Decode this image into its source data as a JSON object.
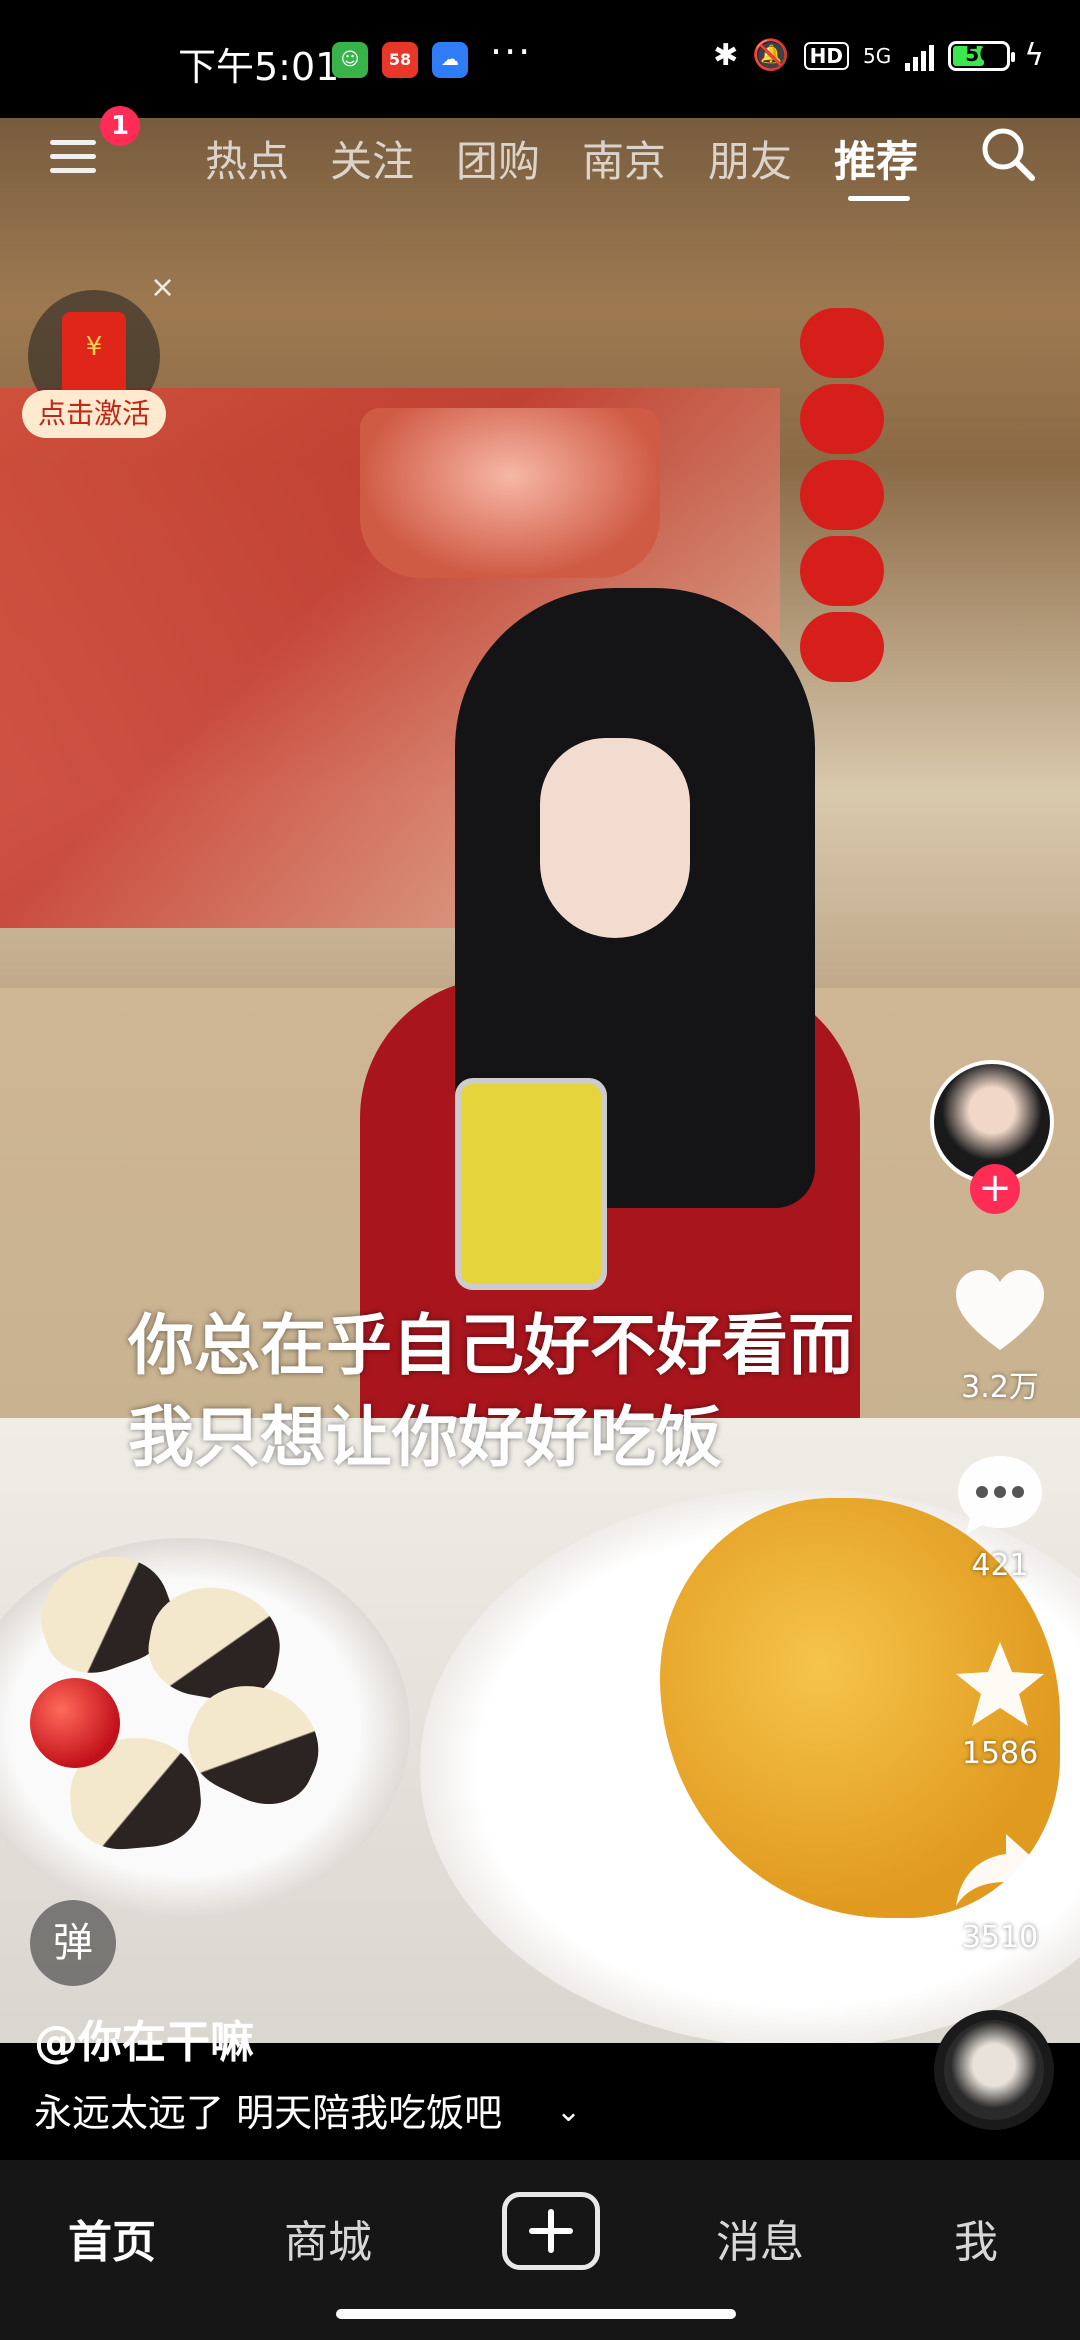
{
  "status_bar": {
    "time": "下午5:01",
    "network": "5G",
    "hd_label": "HD",
    "battery_level": "56",
    "more_dots": "···"
  },
  "top_nav": {
    "menu_badge": "1",
    "tabs": [
      {
        "label": "热点"
      },
      {
        "label": "关注"
      },
      {
        "label": "团购"
      },
      {
        "label": "南京"
      },
      {
        "label": "朋友"
      },
      {
        "label": "推荐",
        "active": true
      }
    ]
  },
  "promo": {
    "label": "点击激活",
    "close": "×"
  },
  "video": {
    "caption_line1": "你总在乎自己好不好看而",
    "caption_line2": "我只想让你好好吃饭"
  },
  "actions": {
    "likes": "3.2万",
    "comments": "421",
    "favorites": "1586",
    "shares": "3510",
    "follow_symbol": "+"
  },
  "post": {
    "author": "@你在干嘛",
    "description": "永远太远了 明天陪我吃饭吧",
    "expand_symbol": "⌄",
    "danmu_label": "弹"
  },
  "bottom_nav": {
    "home": "首页",
    "mall": "商城",
    "messages": "消息",
    "me": "我"
  },
  "colors": {
    "accent": "#ff2d55",
    "tab_bar_bg": "#161616"
  }
}
